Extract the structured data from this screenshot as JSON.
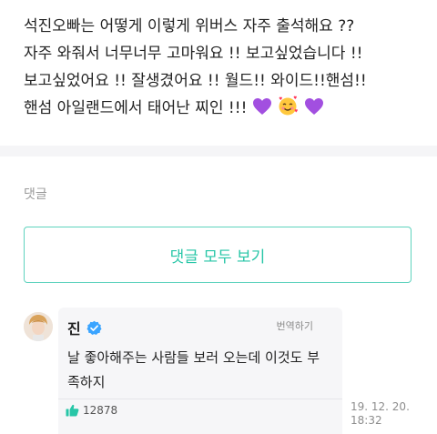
{
  "post": {
    "lines": [
      "석진오빠는 어떻게 이렇게 위버스 자주 출석해요 ??",
      "자주 와줘서 너무너무 고마워요 !! 보고싶었습니다 !!",
      "보고싶었어요 !! 잘생겼어요 !! 월드!! 와이드!!핸섬!!",
      "핸섬 아일랜드에서 태어난 찌인 !!!"
    ],
    "emoji": [
      "purple-heart-icon",
      "smiling-face-with-hearts-icon",
      "purple-heart-icon"
    ]
  },
  "comments_section": {
    "title": "댓글",
    "view_all_label": "댓글 모두 보기"
  },
  "comment": {
    "author": "진",
    "verified_icon": "verified-badge-icon",
    "translate_label": "번역하기",
    "text_lines": [
      "날 좋아해주는 사람들 보러 오는데 이것도 부",
      "족하지"
    ],
    "like_icon": "thumbs-up-icon",
    "likes": "12878",
    "timestamp_lines": [
      "19. 12. 20.",
      "18:32"
    ]
  },
  "colors": {
    "accent": "#27c6a7",
    "verified": "#3aa4ff",
    "heart": "#a24fe0"
  }
}
